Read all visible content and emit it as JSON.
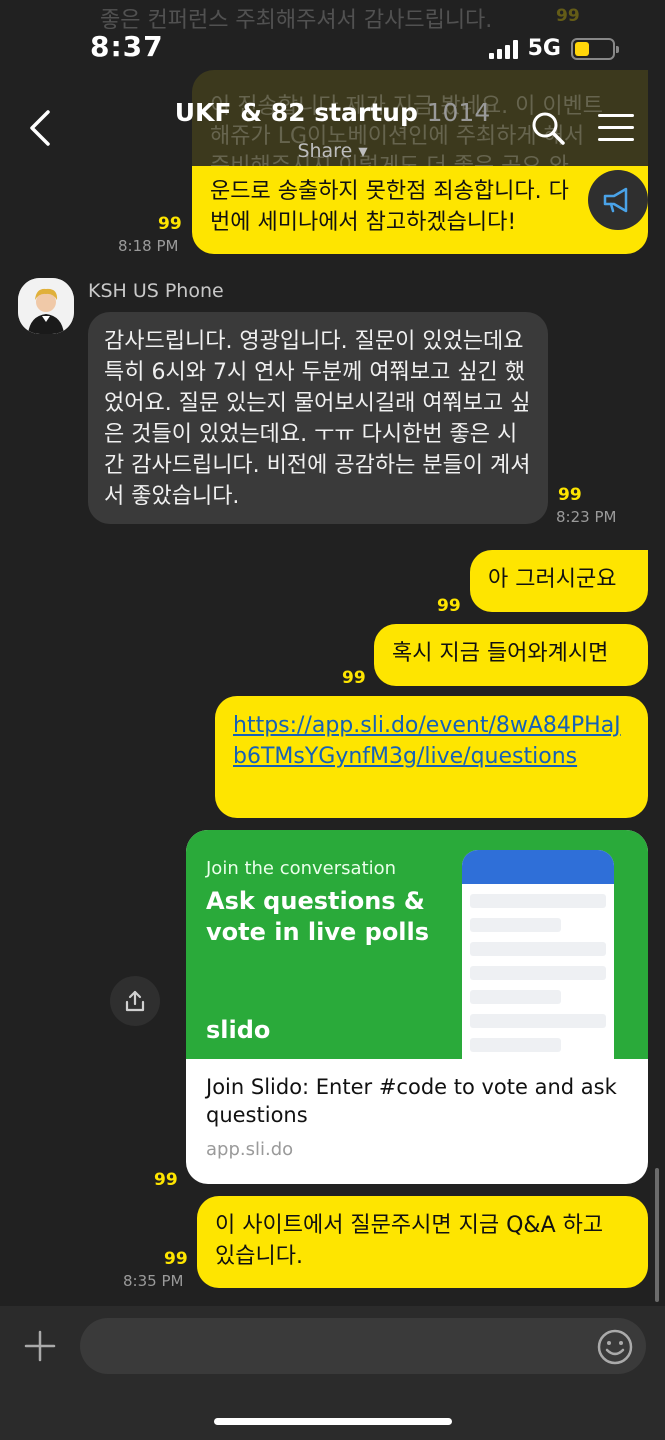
{
  "status": {
    "time": "8:37",
    "network": "5G"
  },
  "background_text": {
    "line_top": "좋은 컨퍼런스 주최해주셔서 감사드립니다.",
    "unread_top": "99",
    "line_1": "이 진송합니다 제가 지금 봤네요. 이 이벤트",
    "line_2": "해쥬가 LG이노베이션인에 주최하게 해서",
    "line_3": "준비해주시지 이렇게도 더 좋은 곡오 와"
  },
  "header": {
    "title": "UKF & 82 startup",
    "member_count": "1014",
    "share_label": "Share"
  },
  "messages": {
    "m1": {
      "lines": [
        "운드로 송출하지 못한점 죄송합니다. 다",
        "번에 세미나에서 참고하겠습니다!"
      ],
      "unread": "99",
      "time": "8:18 PM"
    },
    "m2": {
      "sender": "KSH US Phone",
      "text": "감사드립니다. 영광입니다. 질문이 있었는데요 특히 6시와 7시 연사 두분께 여쭤보고 싶긴 했었어요. 질문 있는지 물어보시길래 여쭤보고 싶은 것들이 있었는데요. ㅜㅠ 다시한번 좋은 시간 감사드립니다. 비전에 공감하는 분들이 계셔서 좋았습니다.",
      "unread": "99",
      "time": "8:23 PM"
    },
    "m3": {
      "text": "아 그러시군요",
      "unread": "99"
    },
    "m4": {
      "text": "혹시 지금 들어와계시면",
      "unread": "99"
    },
    "m5": {
      "link": "https://app.sli.do/event/8wA84PHaJb6TMsYGynfM3g/live/questions"
    },
    "m6": {
      "card_sub": "Join the conversation",
      "card_head": "Ask questions & vote in live polls",
      "card_brand": "slido",
      "card_title": "Join Slido: Enter #code to vote and ask questions",
      "card_url": "app.sli.do",
      "unread": "99"
    },
    "m7": {
      "text": "이 사이트에서 질문주시면 지금 Q&A 하고 있습니다.",
      "unread": "99",
      "time": "8:35 PM"
    }
  },
  "colors": {
    "bubble_yellow": "#fee500",
    "bubble_dark": "#3a3a3a",
    "background": "#212121",
    "slido_green": "#2aaa3a"
  }
}
